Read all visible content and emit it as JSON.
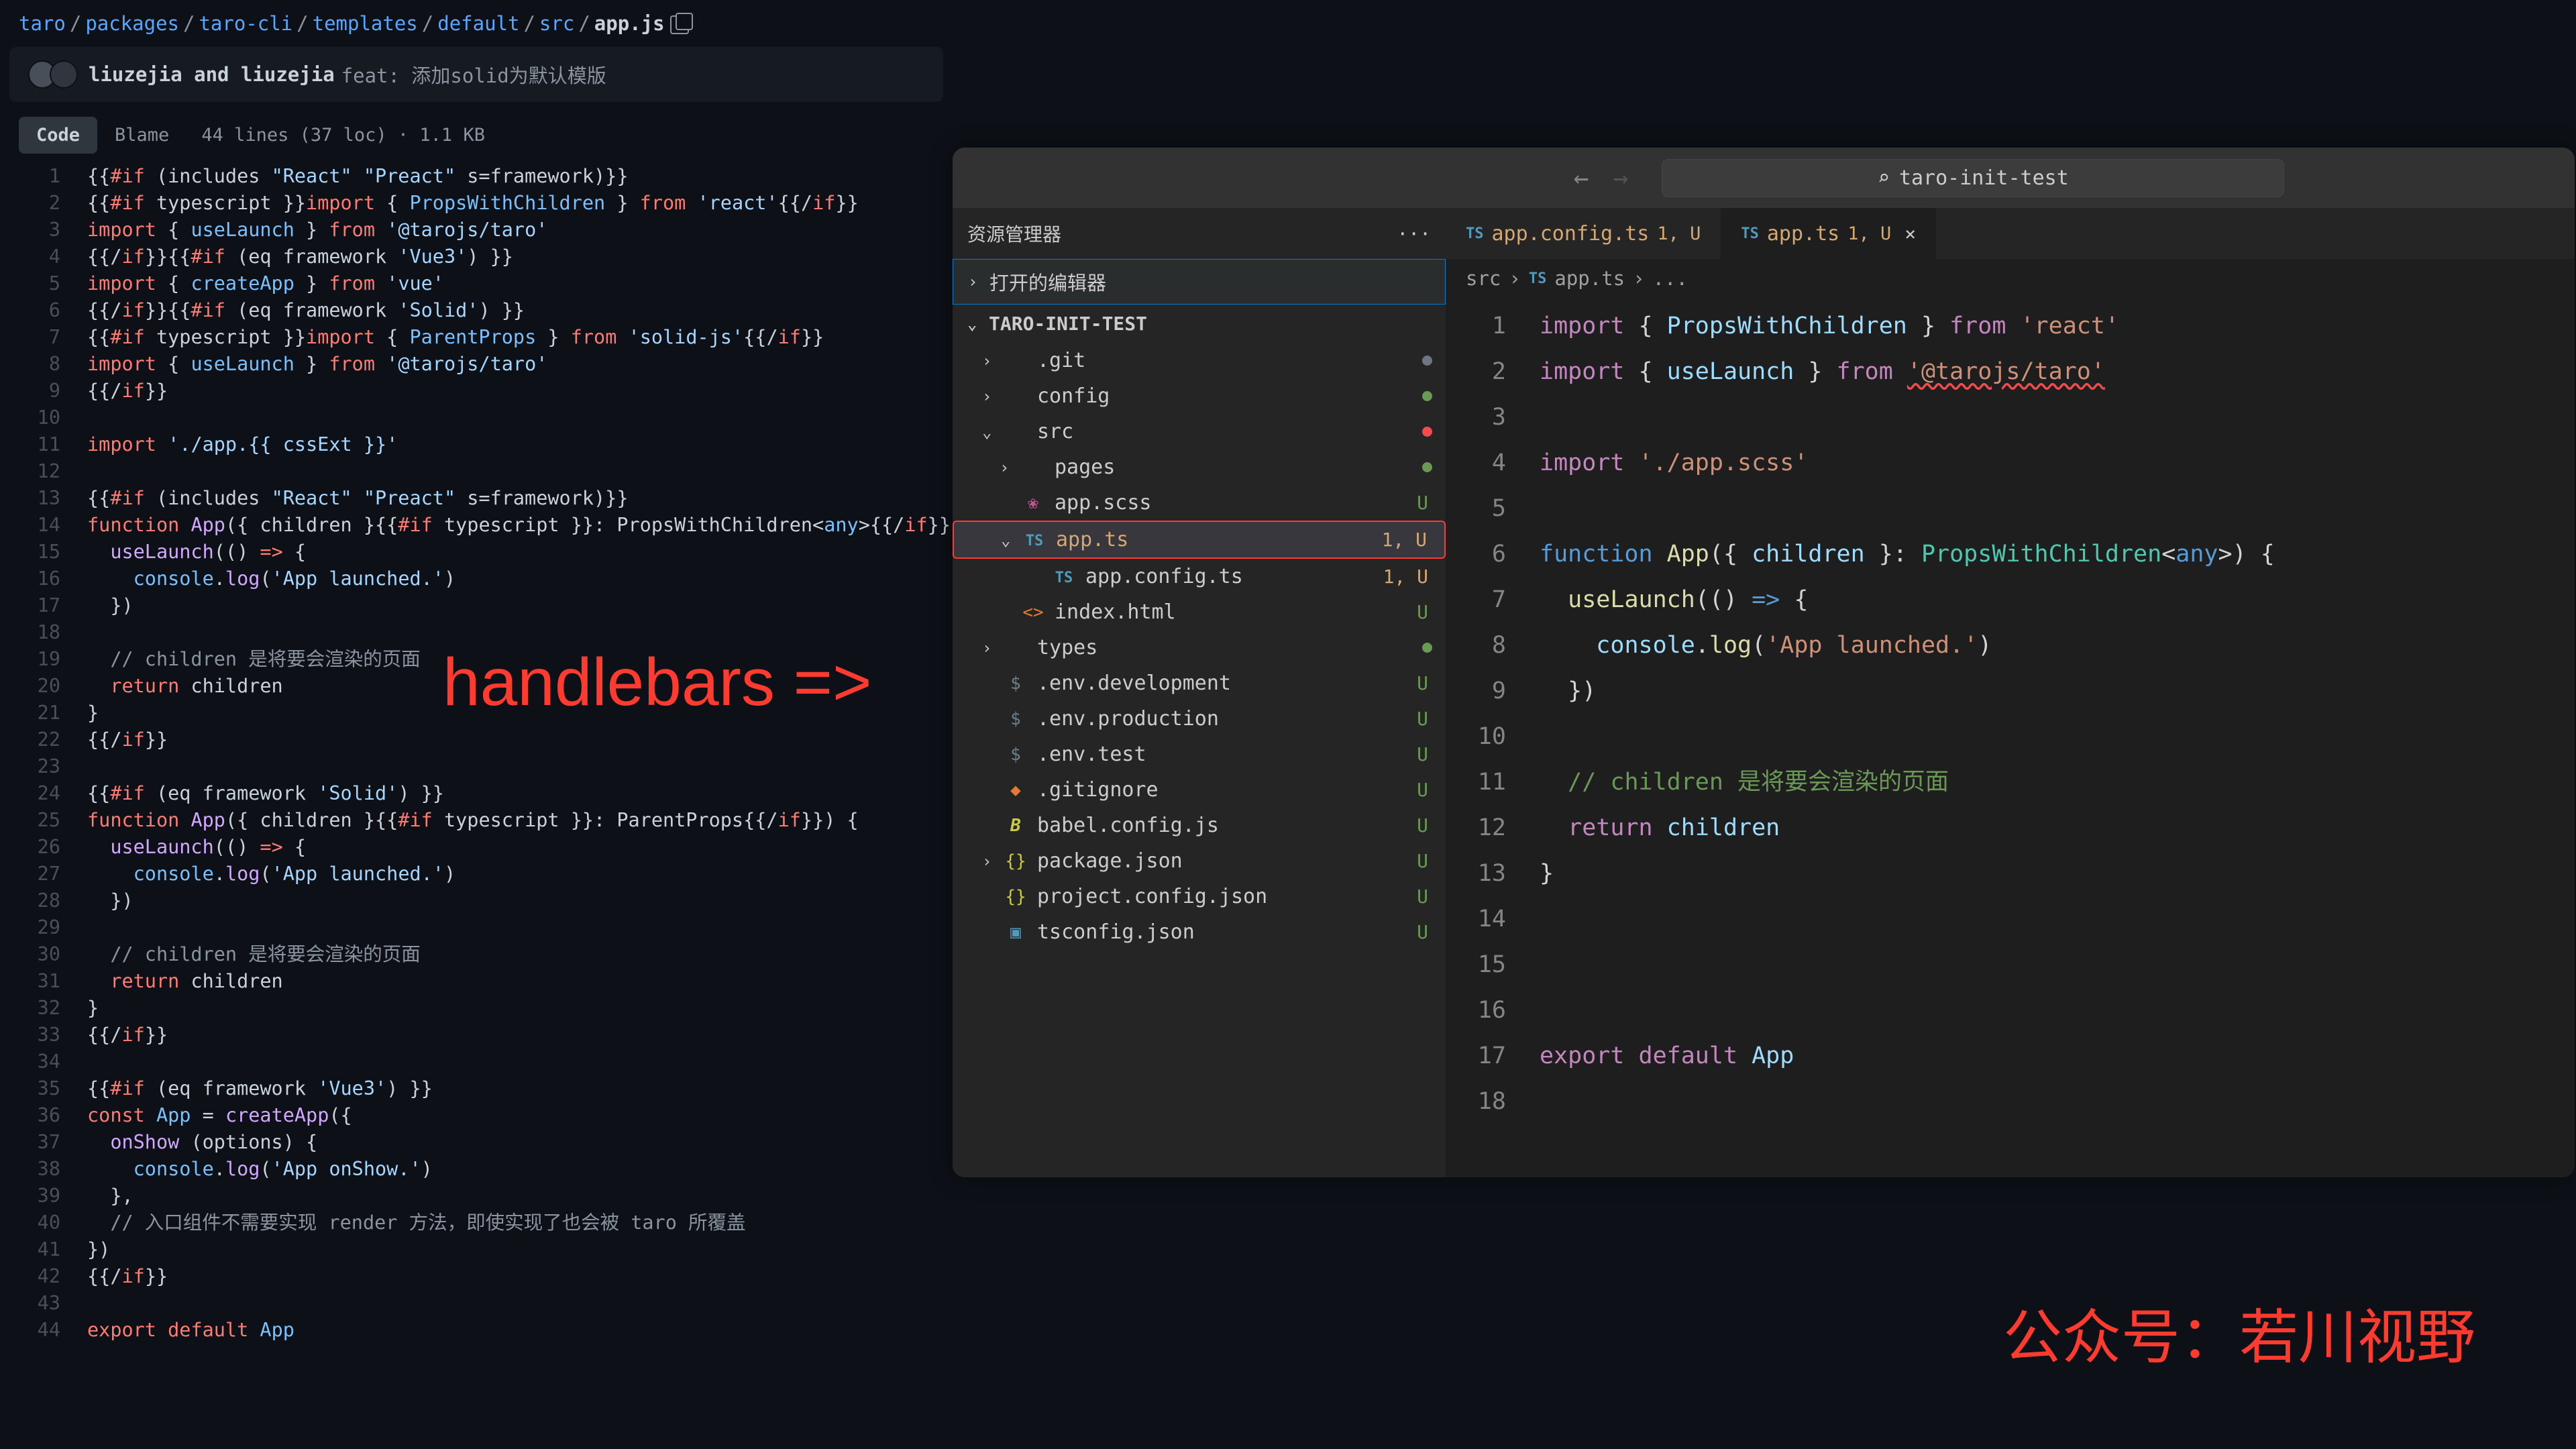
{
  "github": {
    "breadcrumbs": [
      "taro",
      "packages",
      "taro-cli",
      "templates",
      "default",
      "src"
    ],
    "current_file": "app.js",
    "commit": {
      "authors": "liuzejia and liuzejia",
      "message": "feat: 添加solid为默认模版"
    },
    "tabs": {
      "code": "Code",
      "blame": "Blame"
    },
    "stats": "44 lines (37 loc) · 1.1 KB",
    "code": [
      [
        [
          "{{",
          "c-default"
        ],
        [
          "#if",
          "c-red"
        ],
        [
          " (includes ",
          "c-default"
        ],
        [
          "\"React\" \"Preact\"",
          "c-str"
        ],
        [
          " s=framework)",
          "c-default"
        ],
        [
          "}}",
          "c-default"
        ]
      ],
      [
        [
          "{{",
          "c-default"
        ],
        [
          "#if",
          "c-red"
        ],
        [
          " typescript ",
          "c-default"
        ],
        [
          "}}",
          "c-default"
        ],
        [
          "import",
          "c-red"
        ],
        [
          " { ",
          "c-default"
        ],
        [
          "PropsWithChildren",
          "c-blue"
        ],
        [
          " } ",
          "c-default"
        ],
        [
          "from",
          "c-red"
        ],
        [
          " ",
          "c-default"
        ],
        [
          "'react'",
          "c-str"
        ],
        [
          "{{/",
          "c-default"
        ],
        [
          "if",
          "c-red"
        ],
        [
          "}}",
          "c-default"
        ]
      ],
      [
        [
          "import",
          "c-red"
        ],
        [
          " { ",
          "c-default"
        ],
        [
          "useLaunch",
          "c-blue"
        ],
        [
          " } ",
          "c-default"
        ],
        [
          "from",
          "c-red"
        ],
        [
          " ",
          "c-default"
        ],
        [
          "'@tarojs/taro'",
          "c-str"
        ]
      ],
      [
        [
          "{{/",
          "c-default"
        ],
        [
          "if",
          "c-red"
        ],
        [
          "}}{{",
          "c-default"
        ],
        [
          "#if",
          "c-red"
        ],
        [
          " (eq framework ",
          "c-default"
        ],
        [
          "'Vue3'",
          "c-str"
        ],
        [
          ") ",
          "c-default"
        ],
        [
          "}}",
          "c-default"
        ]
      ],
      [
        [
          "import",
          "c-red"
        ],
        [
          " { ",
          "c-default"
        ],
        [
          "createApp",
          "c-blue"
        ],
        [
          " } ",
          "c-default"
        ],
        [
          "from",
          "c-red"
        ],
        [
          " ",
          "c-default"
        ],
        [
          "'vue'",
          "c-str"
        ]
      ],
      [
        [
          "{{/",
          "c-default"
        ],
        [
          "if",
          "c-red"
        ],
        [
          "}}{{",
          "c-default"
        ],
        [
          "#if",
          "c-red"
        ],
        [
          " (eq framework ",
          "c-default"
        ],
        [
          "'Solid'",
          "c-str"
        ],
        [
          ") ",
          "c-default"
        ],
        [
          "}}",
          "c-default"
        ]
      ],
      [
        [
          "{{",
          "c-default"
        ],
        [
          "#if",
          "c-red"
        ],
        [
          " typescript ",
          "c-default"
        ],
        [
          "}}",
          "c-default"
        ],
        [
          "import",
          "c-red"
        ],
        [
          " { ",
          "c-default"
        ],
        [
          "ParentProps",
          "c-blue"
        ],
        [
          " } ",
          "c-default"
        ],
        [
          "from",
          "c-red"
        ],
        [
          " ",
          "c-default"
        ],
        [
          "'solid-js'",
          "c-str"
        ],
        [
          "{{/",
          "c-default"
        ],
        [
          "if",
          "c-red"
        ],
        [
          "}}",
          "c-default"
        ]
      ],
      [
        [
          "import",
          "c-red"
        ],
        [
          " { ",
          "c-default"
        ],
        [
          "useLaunch",
          "c-blue"
        ],
        [
          " } ",
          "c-default"
        ],
        [
          "from",
          "c-red"
        ],
        [
          " ",
          "c-default"
        ],
        [
          "'@tarojs/taro'",
          "c-str"
        ]
      ],
      [
        [
          "{{/",
          "c-default"
        ],
        [
          "if",
          "c-red"
        ],
        [
          "}}",
          "c-default"
        ]
      ],
      [],
      [
        [
          "import",
          "c-red"
        ],
        [
          " ",
          "c-default"
        ],
        [
          "'./app.{{ cssExt }}'",
          "c-str"
        ]
      ],
      [],
      [
        [
          "{{",
          "c-default"
        ],
        [
          "#if",
          "c-red"
        ],
        [
          " (includes ",
          "c-default"
        ],
        [
          "\"React\" \"Preact\"",
          "c-str"
        ],
        [
          " s=framework)",
          "c-default"
        ],
        [
          "}}",
          "c-default"
        ]
      ],
      [
        [
          "function",
          "c-red"
        ],
        [
          " ",
          "c-default"
        ],
        [
          "App",
          "c-purple"
        ],
        [
          "({ children }{{",
          "c-default"
        ],
        [
          "#if",
          "c-red"
        ],
        [
          " typescript ",
          "c-default"
        ],
        [
          "}}: PropsWithChildren<",
          "c-default"
        ],
        [
          "any",
          "c-blue"
        ],
        [
          ">{{/",
          "c-default"
        ],
        [
          "if",
          "c-red"
        ],
        [
          "}}) {",
          "c-default"
        ]
      ],
      [
        [
          "  ",
          "c-default"
        ],
        [
          "useLaunch",
          "c-purple"
        ],
        [
          "(() ",
          "c-default"
        ],
        [
          "=>",
          "c-red"
        ],
        [
          " {",
          "c-default"
        ]
      ],
      [
        [
          "    ",
          "c-default"
        ],
        [
          "console",
          "c-blue"
        ],
        [
          ".",
          "c-default"
        ],
        [
          "log",
          "c-purple"
        ],
        [
          "(",
          "c-default"
        ],
        [
          "'App launched.'",
          "c-str"
        ],
        [
          ")",
          "c-default"
        ]
      ],
      [
        [
          "  })",
          "c-default"
        ]
      ],
      [],
      [
        [
          "  ",
          "c-default"
        ],
        [
          "// children 是将要会渲染的页面",
          "c-gray"
        ]
      ],
      [
        [
          "  ",
          "c-default"
        ],
        [
          "return",
          "c-red"
        ],
        [
          " children",
          "c-default"
        ]
      ],
      [
        [
          "}",
          "c-default"
        ]
      ],
      [
        [
          "{{/",
          "c-default"
        ],
        [
          "if",
          "c-red"
        ],
        [
          "}}",
          "c-default"
        ]
      ],
      [],
      [
        [
          "{{",
          "c-default"
        ],
        [
          "#if",
          "c-red"
        ],
        [
          " (eq framework ",
          "c-default"
        ],
        [
          "'Solid'",
          "c-str"
        ],
        [
          ") ",
          "c-default"
        ],
        [
          "}}",
          "c-default"
        ]
      ],
      [
        [
          "function",
          "c-red"
        ],
        [
          " ",
          "c-default"
        ],
        [
          "App",
          "c-purple"
        ],
        [
          "({ children }{{",
          "c-default"
        ],
        [
          "#if",
          "c-red"
        ],
        [
          " typescript ",
          "c-default"
        ],
        [
          "}}: ParentProps{{/",
          "c-default"
        ],
        [
          "if",
          "c-red"
        ],
        [
          "}}) {",
          "c-default"
        ]
      ],
      [
        [
          "  ",
          "c-default"
        ],
        [
          "useLaunch",
          "c-purple"
        ],
        [
          "(() ",
          "c-default"
        ],
        [
          "=>",
          "c-red"
        ],
        [
          " {",
          "c-default"
        ]
      ],
      [
        [
          "    ",
          "c-default"
        ],
        [
          "console",
          "c-blue"
        ],
        [
          ".",
          "c-default"
        ],
        [
          "log",
          "c-purple"
        ],
        [
          "(",
          "c-default"
        ],
        [
          "'App launched.'",
          "c-str"
        ],
        [
          ")",
          "c-default"
        ]
      ],
      [
        [
          "  })",
          "c-default"
        ]
      ],
      [],
      [
        [
          "  ",
          "c-default"
        ],
        [
          "// children 是将要会渲染的页面",
          "c-gray"
        ]
      ],
      [
        [
          "  ",
          "c-default"
        ],
        [
          "return",
          "c-red"
        ],
        [
          " children",
          "c-default"
        ]
      ],
      [
        [
          "}",
          "c-default"
        ]
      ],
      [
        [
          "{{/",
          "c-default"
        ],
        [
          "if",
          "c-red"
        ],
        [
          "}}",
          "c-default"
        ]
      ],
      [],
      [
        [
          "{{",
          "c-default"
        ],
        [
          "#if",
          "c-red"
        ],
        [
          " (eq framework ",
          "c-default"
        ],
        [
          "'Vue3'",
          "c-str"
        ],
        [
          ") ",
          "c-default"
        ],
        [
          "}}",
          "c-default"
        ]
      ],
      [
        [
          "const",
          "c-red"
        ],
        [
          " ",
          "c-default"
        ],
        [
          "App",
          "c-blue"
        ],
        [
          " = ",
          "c-default"
        ],
        [
          "createApp",
          "c-purple"
        ],
        [
          "({",
          "c-default"
        ]
      ],
      [
        [
          "  ",
          "c-default"
        ],
        [
          "onShow",
          "c-purple"
        ],
        [
          " (options) {",
          "c-default"
        ]
      ],
      [
        [
          "    ",
          "c-default"
        ],
        [
          "console",
          "c-blue"
        ],
        [
          ".",
          "c-default"
        ],
        [
          "log",
          "c-purple"
        ],
        [
          "(",
          "c-default"
        ],
        [
          "'App onShow.'",
          "c-str"
        ],
        [
          ")",
          "c-default"
        ]
      ],
      [
        [
          "  },",
          "c-default"
        ]
      ],
      [
        [
          "  ",
          "c-default"
        ],
        [
          "// 入口组件不需要实现 render 方法，即使实现了也会被 taro 所覆盖",
          "c-gray"
        ]
      ],
      [
        [
          "})",
          "c-default"
        ]
      ],
      [
        [
          "{{/",
          "c-default"
        ],
        [
          "if",
          "c-red"
        ],
        [
          "}}",
          "c-default"
        ]
      ],
      [],
      [
        [
          "export",
          "c-red"
        ],
        [
          " ",
          "c-default"
        ],
        [
          "default",
          "c-red"
        ],
        [
          " ",
          "c-default"
        ],
        [
          "App",
          "c-blue"
        ]
      ]
    ]
  },
  "annotation": "handlebars =>",
  "watermark": "公众号：若川视野",
  "vscode": {
    "title": "taro-init-test",
    "explorer_title": "资源管理器",
    "open_editors": "打开的编辑器",
    "project_name": "TARO-INIT-TEST",
    "tree": [
      {
        "depth": 0,
        "chev": "›",
        "icon": "",
        "label": ".git",
        "status": "",
        "dot": "gray"
      },
      {
        "depth": 0,
        "chev": "›",
        "icon": "",
        "label": "config",
        "status": "",
        "dot": "green"
      },
      {
        "depth": 0,
        "chev": "⌄",
        "icon": "",
        "label": "src",
        "status": "",
        "dot": "red",
        "open": true
      },
      {
        "depth": 1,
        "chev": "›",
        "icon": "",
        "label": "pages",
        "status": "",
        "dot": "green"
      },
      {
        "depth": 1,
        "chev": "",
        "icon": "scss",
        "label": "app.scss",
        "status": "U"
      },
      {
        "depth": 1,
        "chev": "⌄",
        "icon": "ts",
        "label": "app.ts",
        "status": "1, U",
        "selected": true
      },
      {
        "depth": 2,
        "chev": "",
        "icon": "ts",
        "label": "app.config.ts",
        "status": "1, U"
      },
      {
        "depth": 1,
        "chev": "",
        "icon": "html",
        "label": "index.html",
        "status": "U"
      },
      {
        "depth": 0,
        "chev": "›",
        "icon": "",
        "label": "types",
        "status": "",
        "dot": "green"
      },
      {
        "depth": 0,
        "chev": "",
        "icon": "dollar",
        "label": ".env.development",
        "status": "U"
      },
      {
        "depth": 0,
        "chev": "",
        "icon": "dollar",
        "label": ".env.production",
        "status": "U"
      },
      {
        "depth": 0,
        "chev": "",
        "icon": "dollar",
        "label": ".env.test",
        "status": "U"
      },
      {
        "depth": 0,
        "chev": "",
        "icon": "git",
        "label": ".gitignore",
        "status": "U"
      },
      {
        "depth": 0,
        "chev": "",
        "icon": "js",
        "label": "babel.config.js",
        "status": "U"
      },
      {
        "depth": 0,
        "chev": "›",
        "icon": "json",
        "label": "package.json",
        "status": "U"
      },
      {
        "depth": 0,
        "chev": "",
        "icon": "json",
        "label": "project.config.json",
        "status": "U"
      },
      {
        "depth": 0,
        "chev": "",
        "icon": "tsconf",
        "label": "tsconfig.json",
        "status": "U"
      }
    ],
    "tabs": [
      {
        "name": "app.config.ts",
        "meta": "1, U",
        "active": false
      },
      {
        "name": "app.ts",
        "meta": "1, U",
        "active": true
      }
    ],
    "crumbs": [
      "src",
      "app.ts",
      "..."
    ],
    "editor": [
      [
        [
          "import",
          "e-purple"
        ],
        [
          " { ",
          "e-default"
        ],
        [
          "PropsWithChildren",
          "e-cyan"
        ],
        [
          " } ",
          "e-default"
        ],
        [
          "from",
          "e-purple"
        ],
        [
          " ",
          "e-default"
        ],
        [
          "'react'",
          "e-str"
        ]
      ],
      [
        [
          "import",
          "e-purple"
        ],
        [
          " { ",
          "e-default"
        ],
        [
          "useLaunch",
          "e-cyan"
        ],
        [
          " } ",
          "e-default"
        ],
        [
          "from",
          "e-purple"
        ],
        [
          " ",
          "e-default"
        ],
        [
          "'@tarojs/taro'",
          "e-str squiggle"
        ]
      ],
      [],
      [
        [
          "import",
          "e-purple"
        ],
        [
          " ",
          "e-default"
        ],
        [
          "'./app.scss'",
          "e-str"
        ]
      ],
      [],
      [
        [
          "function",
          "e-blue"
        ],
        [
          " ",
          "e-default"
        ],
        [
          "App",
          "e-func"
        ],
        [
          "({ ",
          "e-default"
        ],
        [
          "children",
          "e-cyan"
        ],
        [
          " }: ",
          "e-default"
        ],
        [
          "PropsWithChildren",
          "e-type"
        ],
        [
          "<",
          "e-default"
        ],
        [
          "any",
          "e-blue"
        ],
        [
          ">) {",
          "e-default"
        ]
      ],
      [
        [
          "  ",
          "e-default"
        ],
        [
          "useLaunch",
          "e-func"
        ],
        [
          "(() ",
          "e-default"
        ],
        [
          "=>",
          "e-blue"
        ],
        [
          " {",
          "e-default"
        ]
      ],
      [
        [
          "    ",
          "e-default"
        ],
        [
          "console",
          "e-cyan"
        ],
        [
          ".",
          "e-default"
        ],
        [
          "log",
          "e-func"
        ],
        [
          "(",
          "e-default"
        ],
        [
          "'App launched.'",
          "e-str"
        ],
        [
          ")",
          "e-default"
        ]
      ],
      [
        [
          "  })",
          "e-default"
        ]
      ],
      [],
      [
        [
          "  ",
          "e-default"
        ],
        [
          "// children 是将要会渲染的页面",
          "e-gray"
        ]
      ],
      [
        [
          "  ",
          "e-default"
        ],
        [
          "return",
          "e-purple"
        ],
        [
          " ",
          "e-default"
        ],
        [
          "children",
          "e-cyan"
        ]
      ],
      [
        [
          "}",
          "e-default"
        ]
      ],
      [],
      [],
      [],
      [
        [
          "export",
          "e-purple"
        ],
        [
          " ",
          "e-default"
        ],
        [
          "default",
          "e-purple"
        ],
        [
          " ",
          "e-default"
        ],
        [
          "App",
          "e-cyan"
        ]
      ],
      []
    ]
  }
}
